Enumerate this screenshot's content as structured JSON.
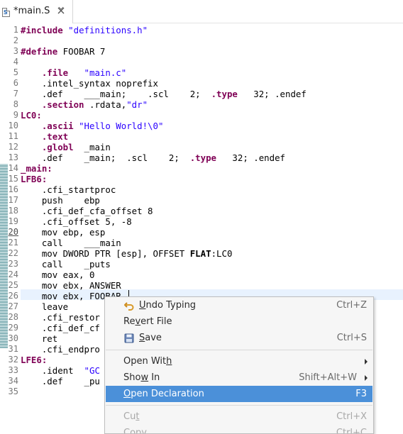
{
  "tab": {
    "file_icon_letter": "S",
    "title": "*main.S",
    "close_icon": "close-icon"
  },
  "editor": {
    "lines": [
      {
        "n": "1",
        "html": "<span class=\"kw\">#include</span> <span class=\"str\">\"definitions.h\"</span>"
      },
      {
        "n": "2",
        "html": ""
      },
      {
        "n": "3",
        "html": "<span class=\"kw\">#define</span> FOOBAR 7"
      },
      {
        "n": "4",
        "html": ""
      },
      {
        "n": "5",
        "html": "    <span class=\"kw\">.file</span>   <span class=\"str\">\"main.c\"</span>"
      },
      {
        "n": "6",
        "html": "    .intel_syntax noprefix"
      },
      {
        "n": "7",
        "html": "    .def    ___main;    .scl    2;  <span class=\"kw\">.type</span>   32; .endef"
      },
      {
        "n": "8",
        "html": "    <span class=\"kw\">.section</span> .rdata,<span class=\"str\">\"dr\"</span>"
      },
      {
        "n": "9",
        "html": "<span class=\"lab\">LC0:</span>"
      },
      {
        "n": "10",
        "html": "    <span class=\"kw\">.ascii</span> <span class=\"str\">\"Hello World!\\0\"</span>"
      },
      {
        "n": "11",
        "html": "    <span class=\"kw\">.text</span>"
      },
      {
        "n": "12",
        "html": "    <span class=\"kw\">.globl</span>  _main"
      },
      {
        "n": "13",
        "html": "    .def    _main;  .scl    2;  <span class=\"kw\">.type</span>   32; .endef"
      },
      {
        "n": "14",
        "html": "<span class=\"lab\">_main:</span>"
      },
      {
        "n": "15",
        "html": "<span class=\"lab\">LFB6:</span>"
      },
      {
        "n": "16",
        "html": "    .cfi_startproc"
      },
      {
        "n": "17",
        "html": "    push    ebp"
      },
      {
        "n": "18",
        "html": "    .cfi_def_cfa_offset 8"
      },
      {
        "n": "19",
        "html": "    .cfi_offset 5, -8"
      },
      {
        "n": "20",
        "html": "    mov ebp, esp"
      },
      {
        "n": "21",
        "html": "    call    ___main"
      },
      {
        "n": "22",
        "html": "    mov DWORD PTR [esp], OFFSET <span class=\"bold\">FLAT</span>:LC0"
      },
      {
        "n": "23",
        "html": "    call    _puts"
      },
      {
        "n": "24",
        "html": "    mov eax, 0"
      },
      {
        "n": "25",
        "html": "    mov ebx, ANSWER"
      },
      {
        "n": "26",
        "html": "    mov ebx, FOOBAR"
      },
      {
        "n": "27",
        "html": "    leave"
      },
      {
        "n": "28",
        "html": "    .cfi_restor"
      },
      {
        "n": "29",
        "html": "    .cfi_def_cf"
      },
      {
        "n": "30",
        "html": "    ret"
      },
      {
        "n": "31",
        "html": "    .cfi_endpro"
      },
      {
        "n": "32",
        "html": "<span class=\"lab\">LFE6:</span>"
      },
      {
        "n": "33",
        "html": "    .ident  <span class=\"str\">\"GC</span>"
      },
      {
        "n": "34",
        "html": "    .def    _pu"
      },
      {
        "n": "35",
        "html": ""
      }
    ]
  },
  "context_menu": {
    "undo_icon": "undo-icon",
    "save_icon": "save-icon",
    "items": {
      "undo": {
        "pre": "",
        "u": "U",
        "post": "ndo Typing",
        "accel": "Ctrl+Z"
      },
      "revert": {
        "pre": "Re",
        "u": "v",
        "post": "ert File",
        "accel": ""
      },
      "save": {
        "pre": "",
        "u": "S",
        "post": "ave",
        "accel": "Ctrl+S"
      },
      "open_with": {
        "pre": "Open Wit",
        "u": "h",
        "post": "",
        "accel": ""
      },
      "show_in": {
        "pre": "Sho",
        "u": "w",
        "post": " In",
        "accel": "Shift+Alt+W"
      },
      "open_declaration": {
        "pre": "",
        "u": "O",
        "post": "pen Declaration",
        "accel": "F3"
      },
      "cut": {
        "pre": "Cu",
        "u": "t",
        "post": "",
        "accel": "Ctrl+X"
      },
      "copy": {
        "pre": "",
        "u": "C",
        "post": "opy",
        "accel": "Ctrl+C"
      }
    }
  }
}
